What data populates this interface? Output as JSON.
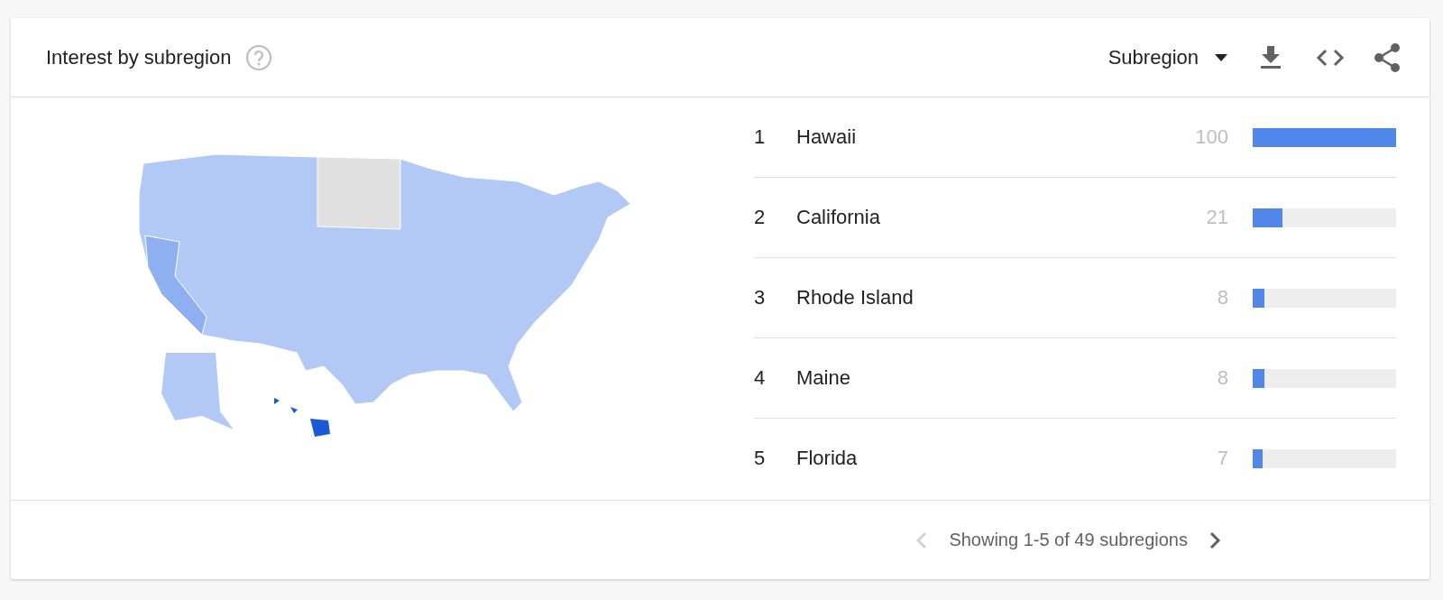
{
  "header": {
    "title": "Interest by subregion",
    "dropdown": {
      "label": "Subregion"
    }
  },
  "rows": [
    {
      "rank": "1",
      "name": "Hawaii",
      "value": "100",
      "level": 1.0
    },
    {
      "rank": "2",
      "name": "California",
      "value": "21",
      "level": 0.21
    },
    {
      "rank": "3",
      "name": "Rhode Island",
      "value": "8",
      "level": 0.08
    },
    {
      "rank": "4",
      "name": "Maine",
      "value": "8",
      "level": 0.08
    },
    {
      "rank": "5",
      "name": "Florida",
      "value": "7",
      "level": 0.07
    }
  ],
  "pagination": {
    "text": "Showing 1-5 of 49 subregions",
    "previous": {
      "disabled": true
    },
    "next": {
      "disabled": false
    }
  }
}
